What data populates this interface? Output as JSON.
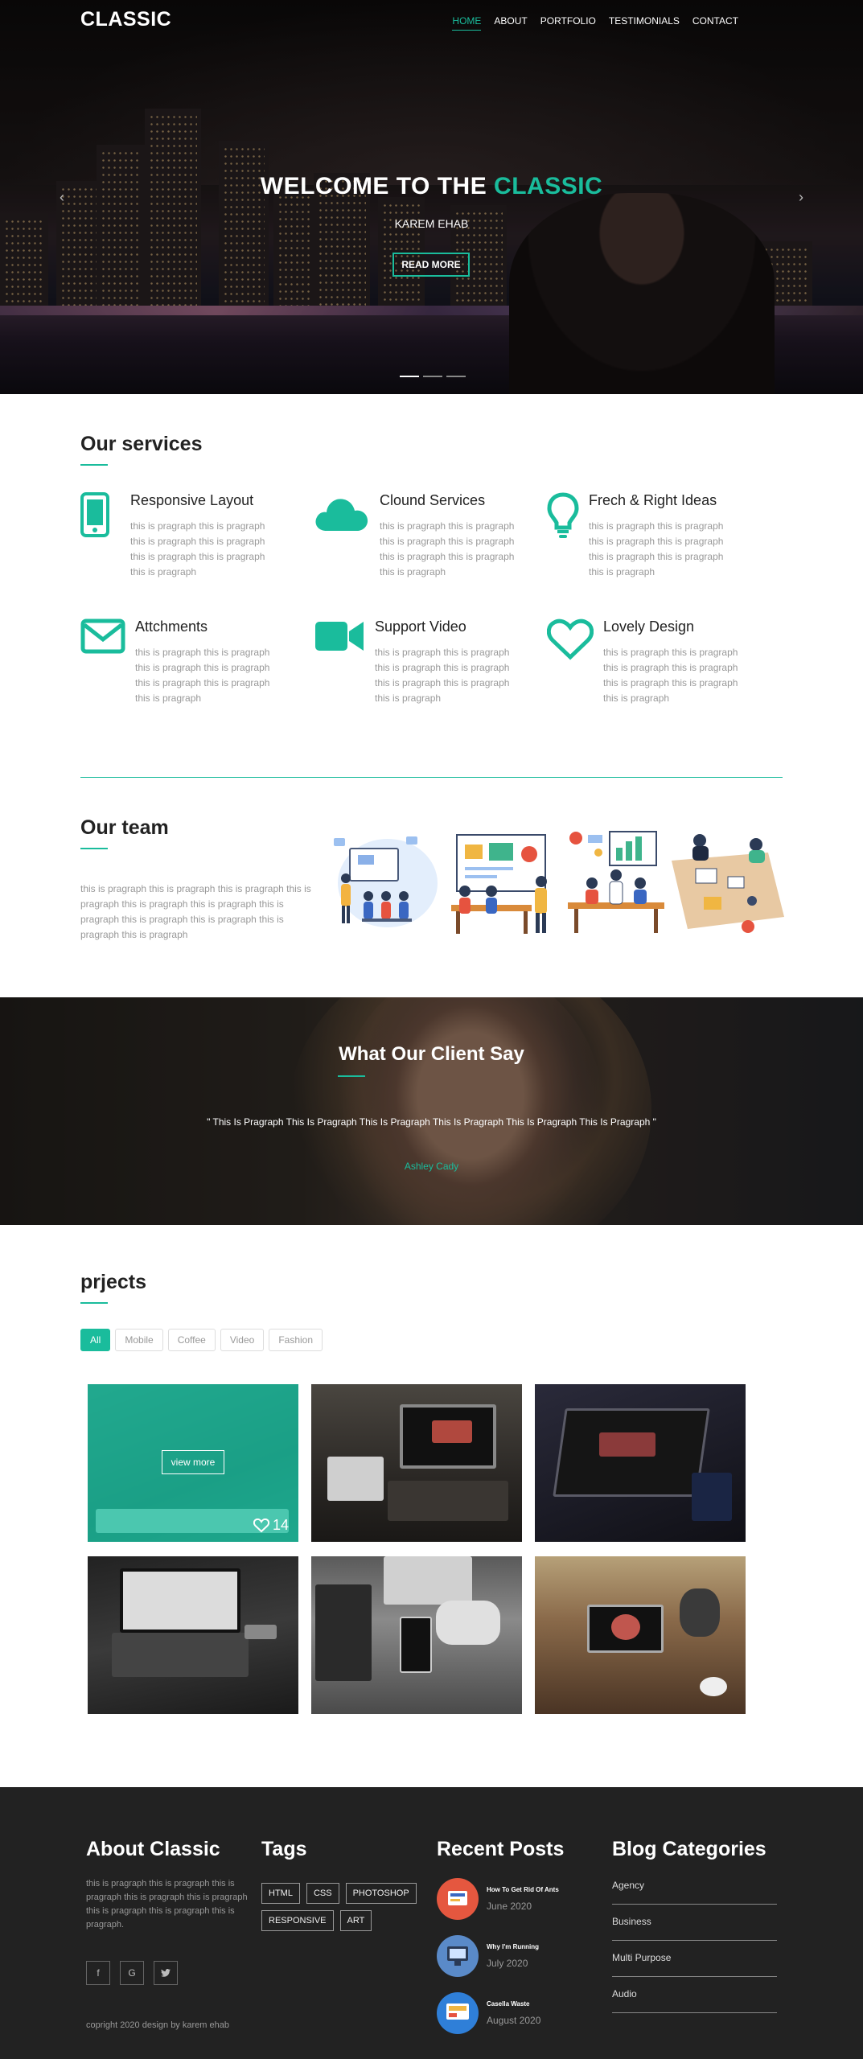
{
  "nav": {
    "logo": "CLASSIC",
    "items": [
      {
        "label": "HOME",
        "active": true
      },
      {
        "label": "ABOUT"
      },
      {
        "label": "PORTFOLIO"
      },
      {
        "label": "TESTIMONIALS"
      },
      {
        "label": "CONTACT"
      }
    ]
  },
  "hero": {
    "title_prefix": "WELCOME TO THE ",
    "title_accent": "CLASSIC",
    "subtitle": "KAREM EHAB",
    "button": "READ MORE",
    "prev_arrow": "‹",
    "next_arrow": "›",
    "slides_count": 3,
    "active_slide": 1
  },
  "services": {
    "title": "Our services",
    "items": [
      {
        "icon": "mobile-icon",
        "title": "Responsive Layout",
        "text": "this is pragraph this is pragraph this is pragraph this is pragraph this is pragraph this is pragraph this is pragraph"
      },
      {
        "icon": "cloud-icon",
        "title": "Clound Services",
        "text": "this is pragraph this is pragraph this is pragraph this is pragraph this is pragraph this is pragraph this is pragraph"
      },
      {
        "icon": "lightbulb-icon",
        "title": "Frech & Right Ideas",
        "text": "this is pragraph this is pragraph this is pragraph this is pragraph this is pragraph this is pragraph this is pragraph"
      },
      {
        "icon": "envelope-icon",
        "title": "Attchments",
        "text": "this is pragraph this is pragraph this is pragraph this is pragraph this is pragraph this is pragraph this is pragraph"
      },
      {
        "icon": "video-camera-icon",
        "title": "Support Video",
        "text": "this is pragraph this is pragraph this is pragraph this is pragraph this is pragraph this is pragraph this is pragraph"
      },
      {
        "icon": "heart-icon",
        "title": "Lovely Design",
        "text": "this is pragraph this is pragraph this is pragraph this is pragraph this is pragraph this is pragraph this is pragraph"
      }
    ]
  },
  "team": {
    "title": "Our team",
    "text": "this is pragraph this is pragraph this is pragraph this is pragraph this is pragraph this is pragraph this is pragraph this is pragraph this is pragraph this is pragraph this is pragraph"
  },
  "testimonial": {
    "title": "What Our Client Say",
    "quote": "\" This Is Pragraph This Is Pragraph This Is Pragraph This Is Pragraph This Is Pragraph This Is Pragraph \"",
    "client": "Ashley Cady"
  },
  "projects": {
    "title": "prjects",
    "filters": [
      {
        "label": "All",
        "active": true
      },
      {
        "label": "Mobile"
      },
      {
        "label": "Coffee"
      },
      {
        "label": "Video"
      },
      {
        "label": "Fashion"
      }
    ],
    "overlay_button": "view more",
    "likes": "14"
  },
  "footer": {
    "about_title": "About Classic",
    "about_text": "this is pragraph this is pragraph this is pragraph this is pragraph this is pragraph this is pragraph this is pragraph this is pragraph.",
    "social": [
      {
        "icon": "facebook-icon",
        "glyph": "f"
      },
      {
        "icon": "google-icon",
        "glyph": "G"
      },
      {
        "icon": "twitter-icon",
        "glyph": "t"
      }
    ],
    "copyright": "copright 2020 design by karem ehab",
    "tags_title": "Tags",
    "tags": [
      "HTML",
      "CSS",
      "PHOTOSHOP",
      "RESPONSIVE",
      "ART"
    ],
    "posts_title": "Recent Posts",
    "posts": [
      {
        "title": "How To Get Rid Of Ants",
        "date": "June 2020"
      },
      {
        "title": "Why I'm Running",
        "date": "July 2020"
      },
      {
        "title": "Casella Waste",
        "date": "August 2020"
      }
    ],
    "categories_title": "Blog Categories",
    "categories": [
      "Agency",
      "Business",
      "Multi Purpose",
      "Audio"
    ]
  },
  "colors": {
    "accent": "#1abc9c",
    "footer_bg": "#222222"
  }
}
